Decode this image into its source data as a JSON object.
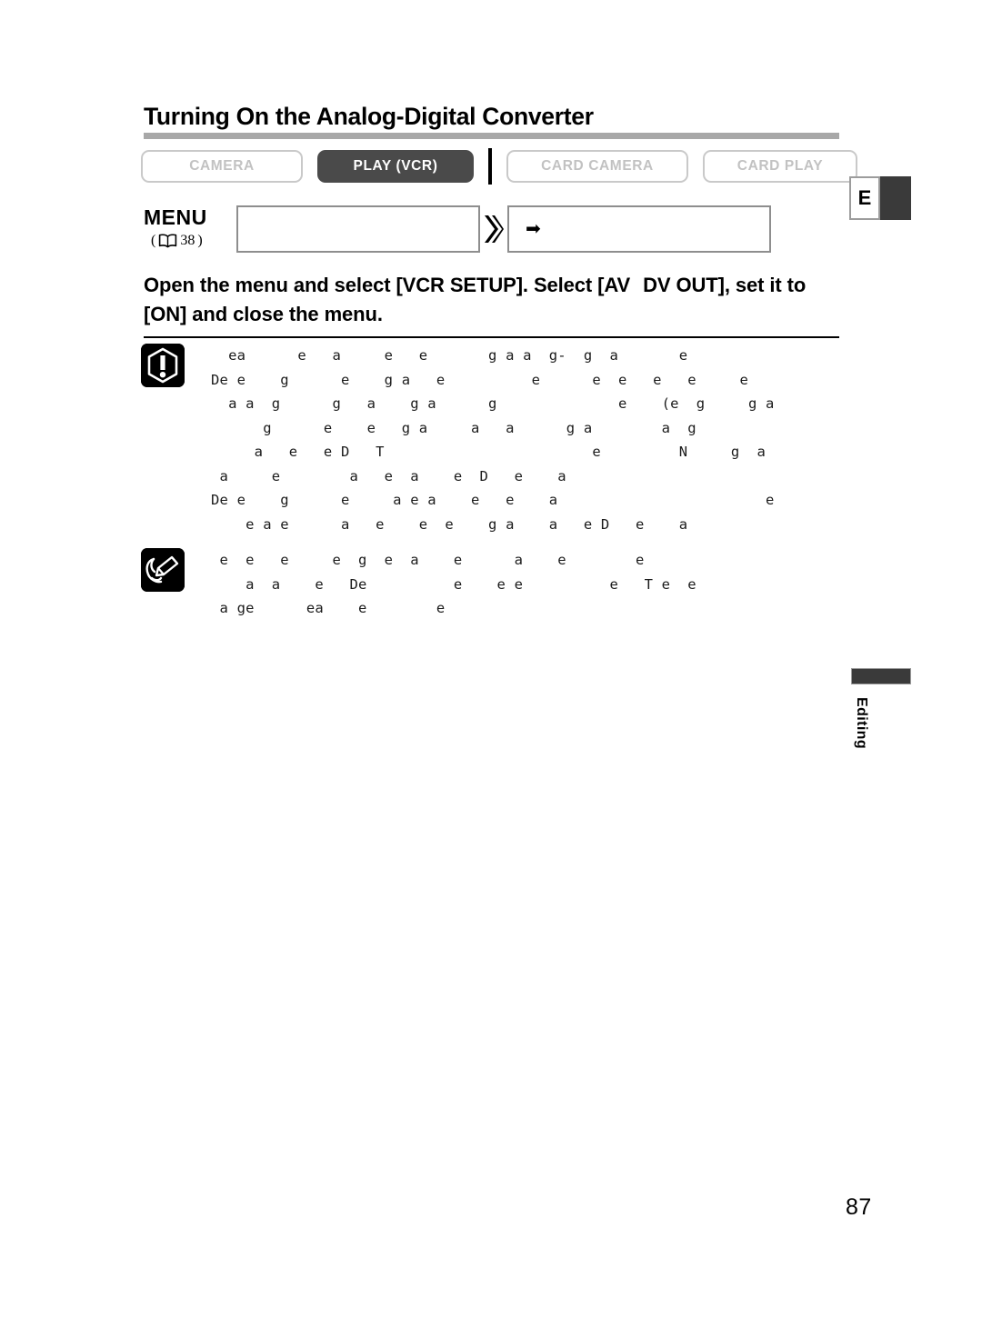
{
  "page": {
    "number": "87",
    "corner_tab": {
      "letter": "E"
    },
    "side_tab": {
      "label": "Editing"
    }
  },
  "heading": {
    "title": "Turning On the Analog-Digital Converter"
  },
  "mode_tabs": [
    {
      "label": "CAMERA",
      "active": false
    },
    {
      "label": "PLAY (VCR)",
      "active": true
    },
    {
      "label": "CARD CAMERA",
      "active": false
    },
    {
      "label": "CARD PLAY",
      "active": false
    }
  ],
  "menu_row": {
    "label": "MENU",
    "reference_open": "(",
    "reference_page": "38",
    "reference_close": ")",
    "book_icon": "book-icon",
    "box_1_text": "",
    "chevron": "❯❯",
    "box_2_text": "",
    "box_2_arrow": "➡"
  },
  "instruction": {
    "line_1_a": "Open the menu and select [VCR SETUP]. Select [AV",
    "line_1_b": "DV OUT], set it to",
    "line_2": "[ON] and close the menu."
  },
  "notes": [
    {
      "icon": "warning-exclamation-icon",
      "lines": [
        "  ea      e   a     e   e       g a a  g-  g  a       e",
        "De e    g      e    g a   e          e      e  e   e   e     e",
        "  a a  g      g   a    g a      g              e    (e  g     g a",
        "      g      e    e   g a     a   a      g a        a  g",
        "     a   e   e D   T                        e         N     g  a",
        " a     e        a   e  a    e  D   e    a",
        "De e    g      e     a e a    e   e    a                        e",
        "    e a e      a   e    e  e    g a    a   e D   e    a"
      ]
    },
    {
      "icon": "note-pencil-icon",
      "lines": [
        " e  e   e     e  g  e  a    e      a    e        e",
        "    a  a    e   De          e    e e          e   T e  e",
        " a ge      ea    e        e"
      ]
    }
  ],
  "colors": {
    "accent_dark": "#4a4a4a",
    "rule_gray": "#a8a8a8",
    "tab_border": "#c9c9c9",
    "tab_text_off": "#c2c2c2",
    "box_border": "#8e8e8e"
  }
}
